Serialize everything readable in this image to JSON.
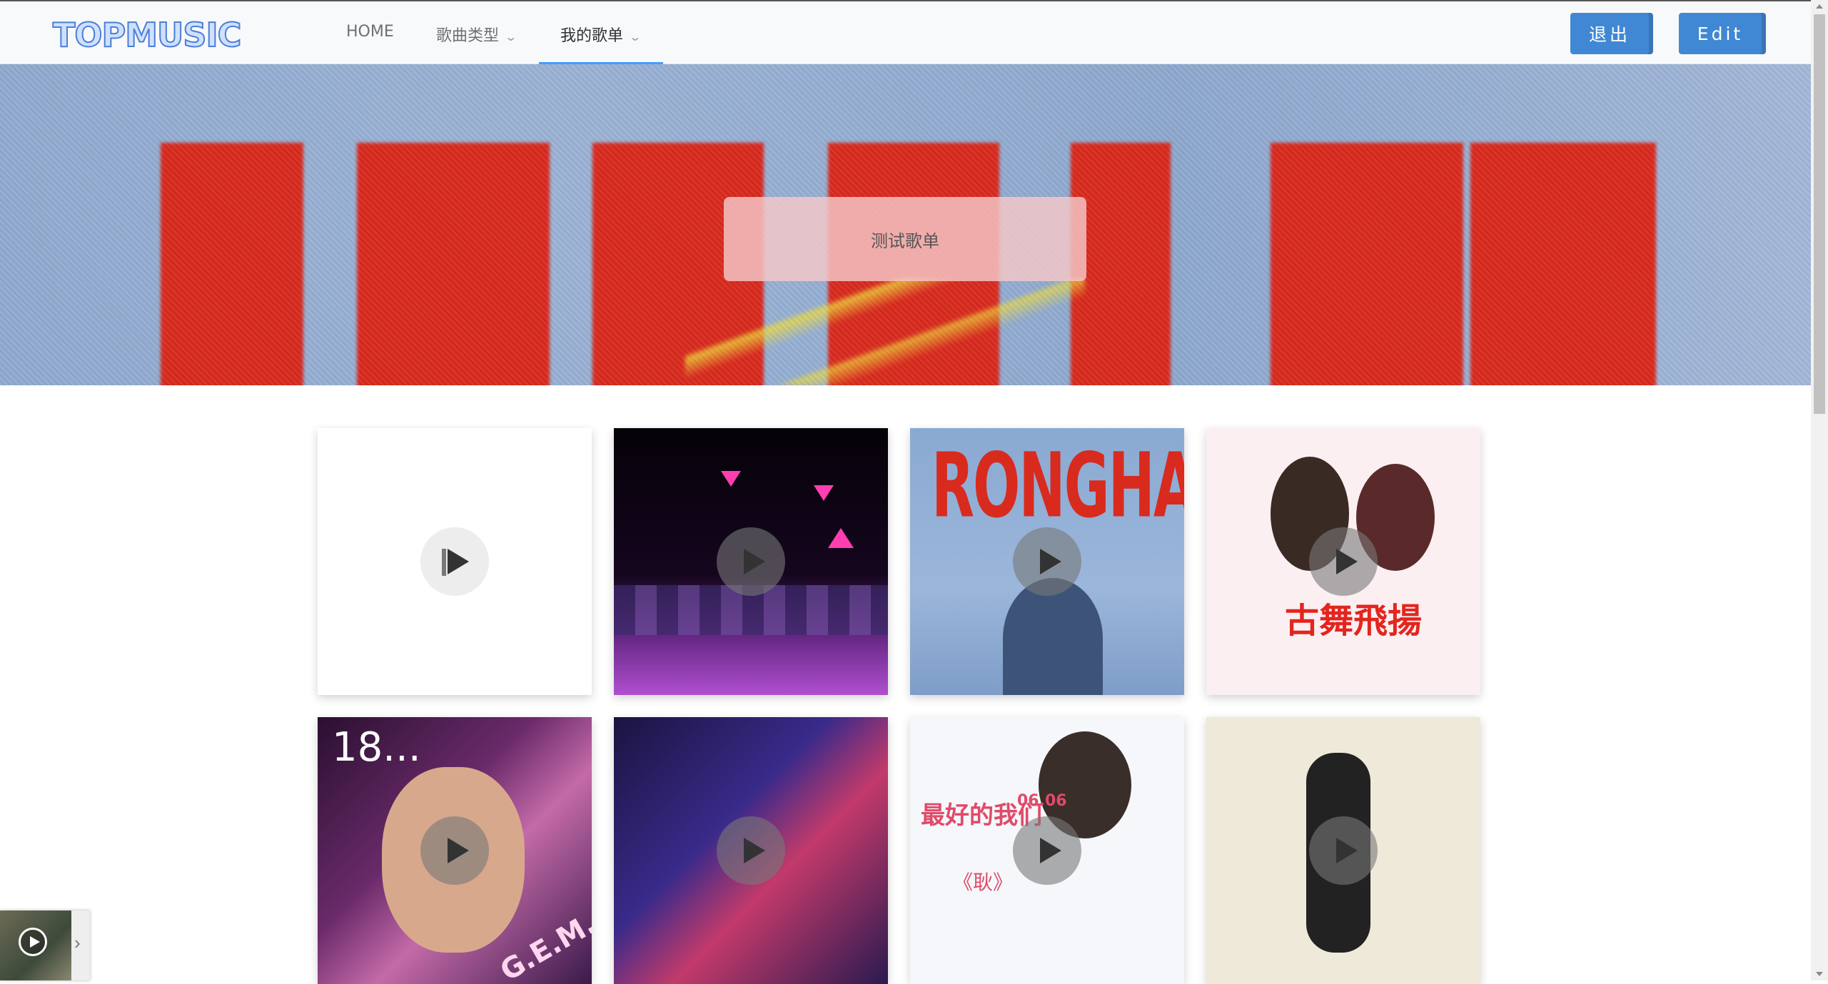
{
  "header": {
    "logo": "TOPMUSIC",
    "nav": [
      {
        "label": "HOME"
      },
      {
        "label": "歌曲类型"
      },
      {
        "label": "我的歌单"
      }
    ],
    "logout_label": "退出",
    "edit_label": "Edit"
  },
  "banner": {
    "title": "测试歌单"
  },
  "covers": {
    "ronghao_text": "RONGHAO",
    "gem_number": "18...",
    "gem_name": "G.E.M.",
    "gufei_title": "古舞飛揚",
    "yongqi_title": "最好的我们",
    "yongqi_date": "06.06",
    "yongqi_sub": "《耿》"
  },
  "colors": {
    "accent": "#409eff",
    "button": "#4088d4",
    "banner_red": "#d92a1e"
  }
}
